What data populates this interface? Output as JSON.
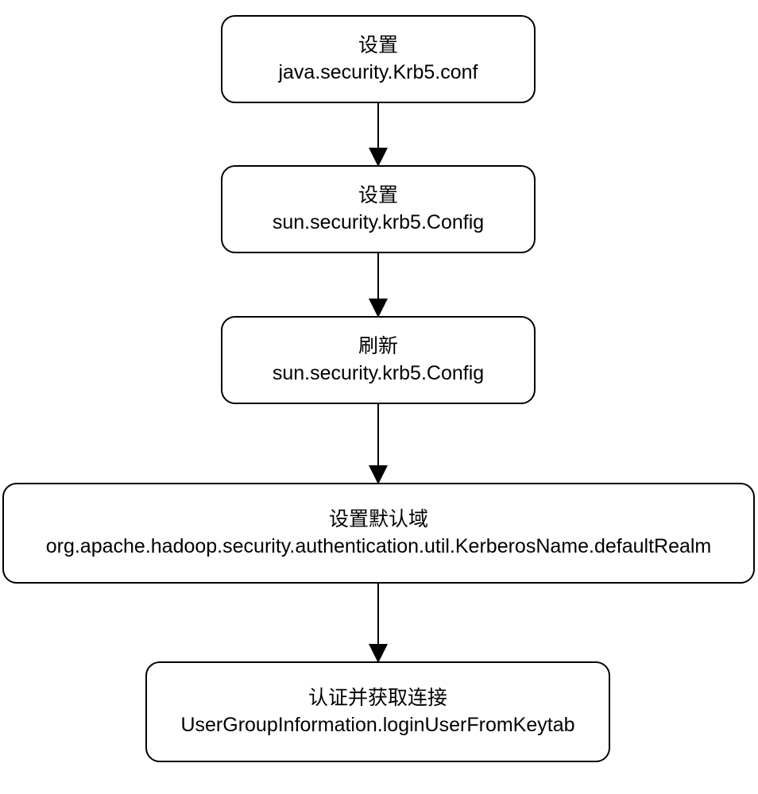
{
  "diagram": {
    "nodes": [
      {
        "id": "n1",
        "title": "设置",
        "detail": "java.security.Krb5.conf"
      },
      {
        "id": "n2",
        "title": "设置",
        "detail": "sun.security.krb5.Config"
      },
      {
        "id": "n3",
        "title": "刷新",
        "detail": "sun.security.krb5.Config"
      },
      {
        "id": "n4",
        "title": "设置默认域",
        "detail": "org.apache.hadoop.security.authentication.util.KerberosName.defaultRealm"
      },
      {
        "id": "n5",
        "title": "认证并获取连接",
        "detail": "UserGroupInformation.loginUserFromKeytab"
      }
    ],
    "edges": [
      {
        "from": "n1",
        "to": "n2"
      },
      {
        "from": "n2",
        "to": "n3"
      },
      {
        "from": "n3",
        "to": "n4"
      },
      {
        "from": "n4",
        "to": "n5"
      }
    ]
  }
}
